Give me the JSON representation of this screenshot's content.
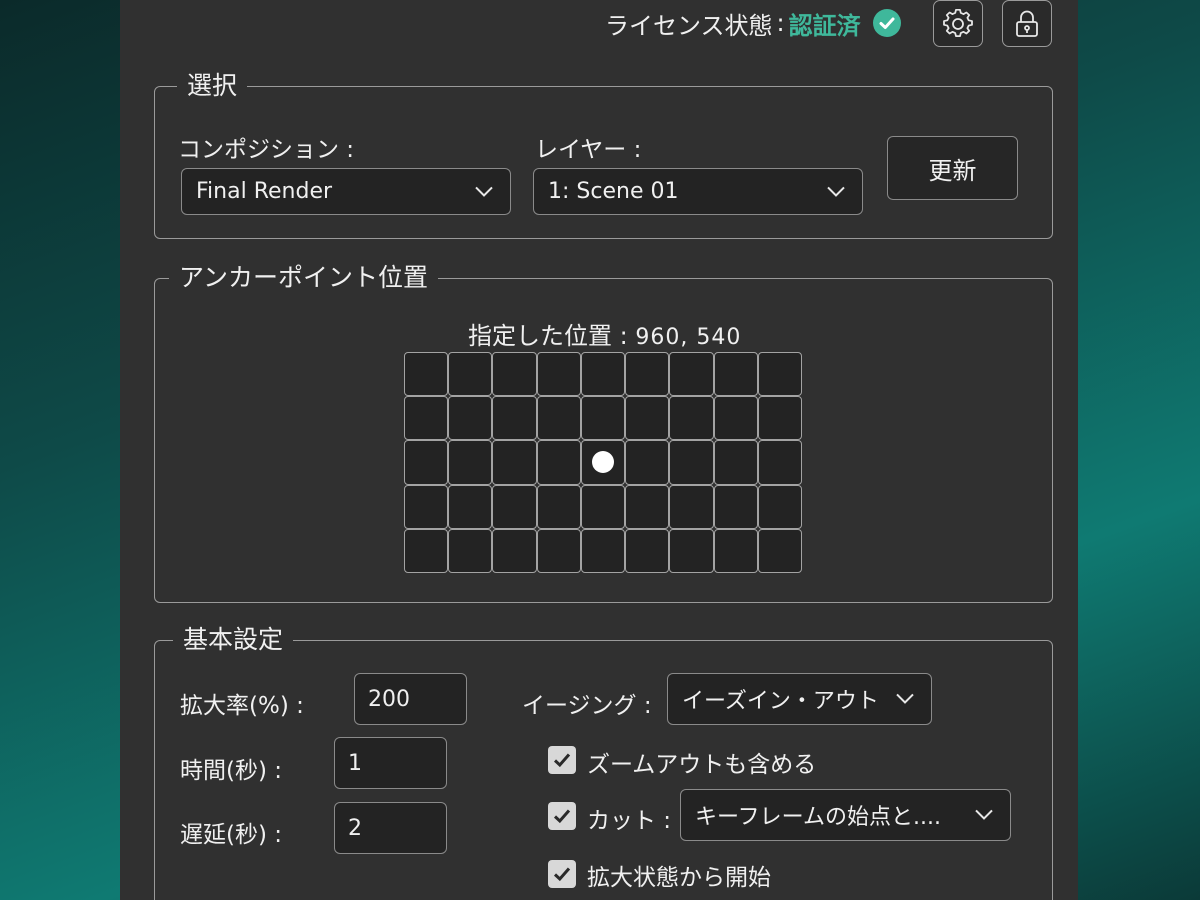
{
  "header": {
    "license_label": "ライセンス状態",
    "license_colon": ":",
    "license_status": "認証済",
    "status_color": "#3fb89b",
    "settings_icon": "gear-icon",
    "lock_icon": "lock-icon"
  },
  "selection": {
    "legend": "選択",
    "composition_label": "コンポジション :",
    "composition_value": "Final Render",
    "layer_label": "レイヤー :",
    "layer_value": "1: Scene 01",
    "refresh_label": "更新"
  },
  "anchor": {
    "legend": "アンカーポイント位置",
    "position_label": "指定した位置 :",
    "position_value": "960, 540",
    "grid_columns": 9,
    "grid_rows": 5,
    "selected_column": 5,
    "selected_row": 3
  },
  "basic": {
    "legend": "基本設定",
    "scale_label": "拡大率(%) :",
    "scale_value": "200",
    "time_label": "時間(秒) :",
    "time_value": "1",
    "delay_label": "遅延(秒) :",
    "delay_value": "2",
    "easing_label": "イージング :",
    "easing_value": "イーズイン・アウト",
    "zoom_out_label": "ズームアウトも含める",
    "zoom_out_checked": true,
    "cut_label": "カット :",
    "cut_checked": true,
    "cut_value": "キーフレームの始点と....",
    "start_zoomed_label": "拡大状態から開始",
    "start_zoomed_checked": true
  }
}
